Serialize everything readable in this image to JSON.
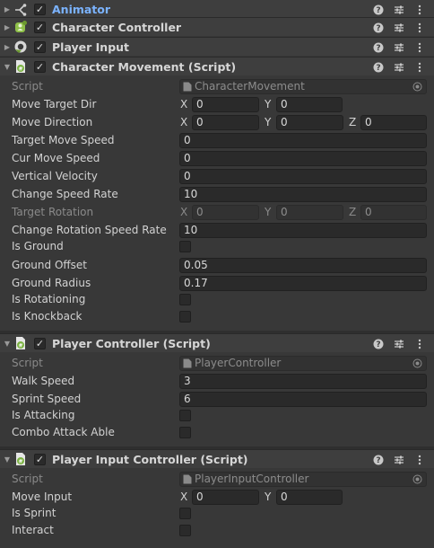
{
  "components": {
    "animator": {
      "title": "Animator",
      "enabled": true
    },
    "character_controller": {
      "title": "Character Controller",
      "enabled": true
    },
    "player_input": {
      "title": "Player Input",
      "enabled": true
    },
    "character_movement": {
      "title": "Character Movement (Script)",
      "enabled": true,
      "script_label": "Script",
      "script_value": "CharacterMovement",
      "fields": {
        "move_target_dir": {
          "label": "Move Target Dir",
          "x_axis": "X",
          "x": "0",
          "y_axis": "Y",
          "y": "0"
        },
        "move_direction": {
          "label": "Move Direction",
          "x_axis": "X",
          "x": "0",
          "y_axis": "Y",
          "y": "0",
          "z_axis": "Z",
          "z": "0"
        },
        "target_move_speed": {
          "label": "Target Move Speed",
          "value": "0"
        },
        "cur_move_speed": {
          "label": "Cur Move Speed",
          "value": "0"
        },
        "vertical_velocity": {
          "label": "Vertical Velocity",
          "value": "0"
        },
        "change_speed_rate": {
          "label": "Change Speed Rate",
          "value": "10"
        },
        "target_rotation": {
          "label": "Target Rotation",
          "x_axis": "X",
          "x": "0",
          "y_axis": "Y",
          "y": "0",
          "z_axis": "Z",
          "z": "0"
        },
        "change_rotation_speed_rate": {
          "label": "Change Rotation Speed Rate",
          "value": "10"
        },
        "is_ground": {
          "label": "Is Ground",
          "checked": false
        },
        "ground_offset": {
          "label": "Ground Offset",
          "value": "0.05"
        },
        "ground_radius": {
          "label": "Ground Radius",
          "value": "0.17"
        },
        "is_rotationing": {
          "label": "Is Rotationing",
          "checked": false
        },
        "is_knockback": {
          "label": "Is Knockback",
          "checked": false
        }
      }
    },
    "player_controller": {
      "title": "Player Controller (Script)",
      "enabled": true,
      "script_label": "Script",
      "script_value": "PlayerController",
      "fields": {
        "walk_speed": {
          "label": "Walk Speed",
          "value": "3"
        },
        "sprint_speed": {
          "label": "Sprint Speed",
          "value": "6"
        },
        "is_attacking": {
          "label": "Is Attacking",
          "checked": false
        },
        "combo_attack_able": {
          "label": "Combo Attack Able",
          "checked": false
        }
      }
    },
    "player_input_controller": {
      "title": "Player Input Controller (Script)",
      "enabled": true,
      "script_label": "Script",
      "script_value": "PlayerInputController",
      "fields": {
        "move_input": {
          "label": "Move Input",
          "x_axis": "X",
          "x": "0",
          "y_axis": "Y",
          "y": "0"
        },
        "is_sprint": {
          "label": "Is Sprint",
          "checked": false
        },
        "interact": {
          "label": "Interact",
          "checked": false
        }
      }
    }
  },
  "colors": {
    "background": "#383838",
    "header": "#3e3e3e",
    "field": "#2a2a2a",
    "animator_title": "#7bb3ff"
  },
  "icons": {
    "help": "help-icon",
    "presets": "presets-icon",
    "menu": "kebab-menu-icon",
    "target": "object-picker-icon",
    "script": "script-file-icon"
  }
}
